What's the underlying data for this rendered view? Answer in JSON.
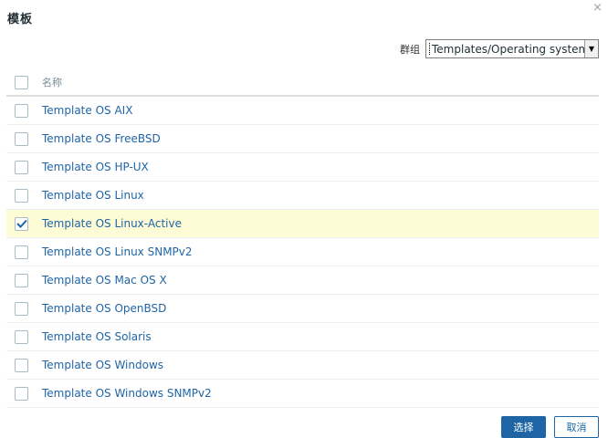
{
  "dialog": {
    "title": "模板",
    "close_glyph": "×"
  },
  "filter": {
    "label": "群组",
    "selected": "Templates/Operating systems"
  },
  "table": {
    "header": "名称",
    "rows": [
      {
        "name": "Template OS AIX",
        "checked": false
      },
      {
        "name": "Template OS FreeBSD",
        "checked": false
      },
      {
        "name": "Template OS HP-UX",
        "checked": false
      },
      {
        "name": "Template OS Linux",
        "checked": false
      },
      {
        "name": "Template OS Linux-Active",
        "checked": true
      },
      {
        "name": "Template OS Linux SNMPv2",
        "checked": false
      },
      {
        "name": "Template OS Mac OS X",
        "checked": false
      },
      {
        "name": "Template OS OpenBSD",
        "checked": false
      },
      {
        "name": "Template OS Solaris",
        "checked": false
      },
      {
        "name": "Template OS Windows",
        "checked": false
      },
      {
        "name": "Template OS Windows SNMPv2",
        "checked": false
      }
    ]
  },
  "footer": {
    "select_label": "选择",
    "cancel_label": "取消"
  },
  "colors": {
    "accent": "#1f65a6",
    "selected_row": "#fefbd7",
    "check": "#1f65a6"
  }
}
